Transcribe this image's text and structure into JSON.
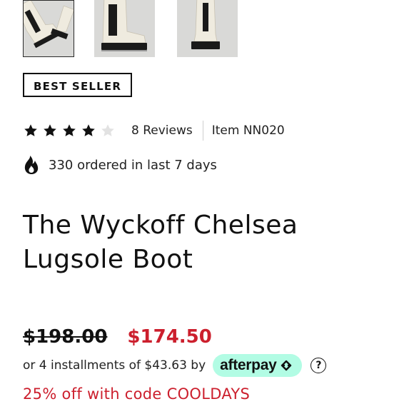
{
  "gallery": {
    "thumbnails": [
      {
        "name": "boot-side-angle-thumbnail",
        "active": true
      },
      {
        "name": "boot-pair-side-thumbnail",
        "active": false
      },
      {
        "name": "boot-pair-back-thumbnail",
        "active": false
      }
    ]
  },
  "badge": {
    "label": "BEST SELLER"
  },
  "rating": {
    "stars_filled": 4,
    "stars_total": 5,
    "reviews_label": "8 Reviews",
    "item_label": "Item NN020"
  },
  "social_proof": {
    "icon": "flame-icon",
    "text": "330 ordered in last 7 days"
  },
  "product": {
    "title": "The Wyckoff Chelsea Lugsole Boot"
  },
  "pricing": {
    "original_price": "$198.00",
    "sale_price": "$174.50",
    "installments_text": "or 4 installments of $43.63 by",
    "afterpay_label": "afterpay",
    "help_symbol": "?"
  },
  "promo": {
    "text": "25% off with code COOLDAYS"
  },
  "colors": {
    "sale_red": "#cc1f2d",
    "afterpay_mint": "#b2fce4",
    "text_dark": "#111111",
    "thumb_bg": "#d9d9d7",
    "boot_cream": "#efebdf",
    "sole_black": "#1a1a1a"
  }
}
